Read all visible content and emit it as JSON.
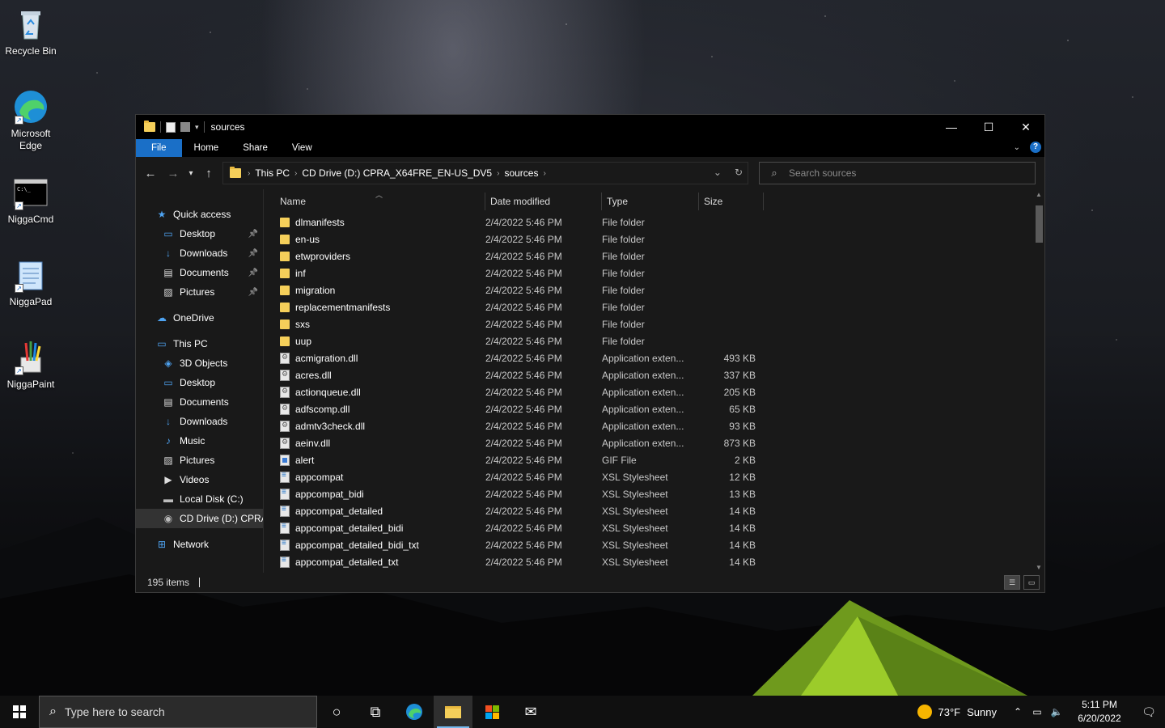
{
  "desktop": {
    "icons": [
      {
        "label": "Recycle Bin",
        "icon": "recycle-bin-icon"
      },
      {
        "label": "Microsoft Edge",
        "icon": "edge-icon"
      },
      {
        "label": "NiggaCmd",
        "icon": "cmd-icon"
      },
      {
        "label": "NiggaPad",
        "icon": "notepad-icon"
      },
      {
        "label": "NiggaPaint",
        "icon": "paint-icon"
      }
    ]
  },
  "window": {
    "title": "sources",
    "controls": {
      "minimize": "—",
      "maximize": "☐",
      "close": "✕"
    },
    "ribbon_tabs": [
      "File",
      "Home",
      "Share",
      "View"
    ],
    "address": {
      "crumbs": [
        "This PC",
        "CD Drive (D:) CPRA_X64FRE_EN-US_DV5",
        "sources"
      ]
    },
    "search": {
      "placeholder": "Search sources",
      "value": ""
    },
    "columns": [
      "Name",
      "Date modified",
      "Type",
      "Size"
    ],
    "nav": [
      {
        "label": "Quick access",
        "icon": "star-icon",
        "level": 0,
        "pinned": false
      },
      {
        "label": "Desktop",
        "icon": "desktop-icon",
        "level": 1,
        "pinned": true
      },
      {
        "label": "Downloads",
        "icon": "download-icon",
        "level": 1,
        "pinned": true
      },
      {
        "label": "Documents",
        "icon": "document-icon",
        "level": 1,
        "pinned": true
      },
      {
        "label": "Pictures",
        "icon": "picture-icon",
        "level": 1,
        "pinned": true
      },
      {
        "label": "OneDrive",
        "icon": "cloud-icon",
        "level": 0,
        "pinned": false
      },
      {
        "label": "This PC",
        "icon": "computer-icon",
        "level": 0,
        "pinned": false
      },
      {
        "label": "3D Objects",
        "icon": "cube-icon",
        "level": 1,
        "pinned": false
      },
      {
        "label": "Desktop",
        "icon": "desktop-icon",
        "level": 1,
        "pinned": false
      },
      {
        "label": "Documents",
        "icon": "document-icon",
        "level": 1,
        "pinned": false
      },
      {
        "label": "Downloads",
        "icon": "download-icon",
        "level": 1,
        "pinned": false
      },
      {
        "label": "Music",
        "icon": "music-icon",
        "level": 1,
        "pinned": false
      },
      {
        "label": "Pictures",
        "icon": "picture-icon",
        "level": 1,
        "pinned": false
      },
      {
        "label": "Videos",
        "icon": "video-icon",
        "level": 1,
        "pinned": false
      },
      {
        "label": "Local Disk (C:)",
        "icon": "drive-icon",
        "level": 1,
        "pinned": false
      },
      {
        "label": "CD Drive (D:) CPRA",
        "icon": "cd-drive-icon",
        "level": 1,
        "pinned": false,
        "selected": true
      },
      {
        "label": "Network",
        "icon": "network-icon",
        "level": 0,
        "pinned": false
      }
    ],
    "files": [
      {
        "name": "dlmanifests",
        "date": "2/4/2022 5:46 PM",
        "type": "File folder",
        "size": "",
        "kind": "folder"
      },
      {
        "name": "en-us",
        "date": "2/4/2022 5:46 PM",
        "type": "File folder",
        "size": "",
        "kind": "folder"
      },
      {
        "name": "etwproviders",
        "date": "2/4/2022 5:46 PM",
        "type": "File folder",
        "size": "",
        "kind": "folder"
      },
      {
        "name": "inf",
        "date": "2/4/2022 5:46 PM",
        "type": "File folder",
        "size": "",
        "kind": "folder"
      },
      {
        "name": "migration",
        "date": "2/4/2022 5:46 PM",
        "type": "File folder",
        "size": "",
        "kind": "folder"
      },
      {
        "name": "replacementmanifests",
        "date": "2/4/2022 5:46 PM",
        "type": "File folder",
        "size": "",
        "kind": "folder"
      },
      {
        "name": "sxs",
        "date": "2/4/2022 5:46 PM",
        "type": "File folder",
        "size": "",
        "kind": "folder"
      },
      {
        "name": "uup",
        "date": "2/4/2022 5:46 PM",
        "type": "File folder",
        "size": "",
        "kind": "folder"
      },
      {
        "name": "acmigration.dll",
        "date": "2/4/2022 5:46 PM",
        "type": "Application exten...",
        "size": "493 KB",
        "kind": "dll"
      },
      {
        "name": "acres.dll",
        "date": "2/4/2022 5:46 PM",
        "type": "Application exten...",
        "size": "337 KB",
        "kind": "dll"
      },
      {
        "name": "actionqueue.dll",
        "date": "2/4/2022 5:46 PM",
        "type": "Application exten...",
        "size": "205 KB",
        "kind": "dll"
      },
      {
        "name": "adfscomp.dll",
        "date": "2/4/2022 5:46 PM",
        "type": "Application exten...",
        "size": "65 KB",
        "kind": "dll"
      },
      {
        "name": "admtv3check.dll",
        "date": "2/4/2022 5:46 PM",
        "type": "Application exten...",
        "size": "93 KB",
        "kind": "dll"
      },
      {
        "name": "aeinv.dll",
        "date": "2/4/2022 5:46 PM",
        "type": "Application exten...",
        "size": "873 KB",
        "kind": "dll"
      },
      {
        "name": "alert",
        "date": "2/4/2022 5:46 PM",
        "type": "GIF File",
        "size": "2 KB",
        "kind": "gif"
      },
      {
        "name": "appcompat",
        "date": "2/4/2022 5:46 PM",
        "type": "XSL Stylesheet",
        "size": "12 KB",
        "kind": "xsl"
      },
      {
        "name": "appcompat_bidi",
        "date": "2/4/2022 5:46 PM",
        "type": "XSL Stylesheet",
        "size": "13 KB",
        "kind": "xsl"
      },
      {
        "name": "appcompat_detailed",
        "date": "2/4/2022 5:46 PM",
        "type": "XSL Stylesheet",
        "size": "14 KB",
        "kind": "xsl"
      },
      {
        "name": "appcompat_detailed_bidi",
        "date": "2/4/2022 5:46 PM",
        "type": "XSL Stylesheet",
        "size": "14 KB",
        "kind": "xsl"
      },
      {
        "name": "appcompat_detailed_bidi_txt",
        "date": "2/4/2022 5:46 PM",
        "type": "XSL Stylesheet",
        "size": "14 KB",
        "kind": "xsl"
      },
      {
        "name": "appcompat_detailed_txt",
        "date": "2/4/2022 5:46 PM",
        "type": "XSL Stylesheet",
        "size": "14 KB",
        "kind": "xsl"
      }
    ],
    "status": {
      "item_count": "195 items"
    }
  },
  "taskbar": {
    "search_placeholder": "Type here to search",
    "apps": [
      "cortana-icon",
      "task-view-icon",
      "edge-icon",
      "file-explorer-icon",
      "store-icon",
      "mail-icon"
    ],
    "weather": {
      "temp": "73°F",
      "condition": "Sunny"
    },
    "time": "5:11 PM",
    "date": "6/20/2022"
  },
  "colors": {
    "accent": "#1a6fc7",
    "folder": "#f5cf5a",
    "window_bg": "#191919",
    "taskbar_bg": "#101010"
  }
}
